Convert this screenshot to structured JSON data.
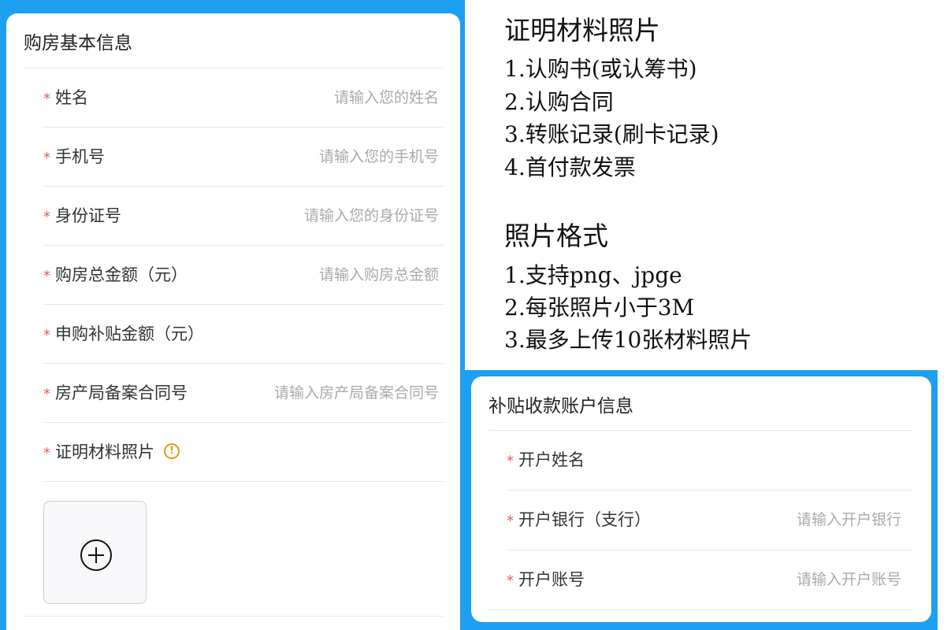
{
  "purchase_card": {
    "title": "购房基本信息",
    "fields": [
      {
        "label": "姓名",
        "placeholder": "请输入您的姓名"
      },
      {
        "label": "手机号",
        "placeholder": "请输入您的手机号"
      },
      {
        "label": "身份证号",
        "placeholder": "请输入您的身份证号"
      },
      {
        "label": "购房总金额（元）",
        "placeholder": "请输入购房总金额"
      },
      {
        "label": "申购补贴金额（元）",
        "placeholder": ""
      },
      {
        "label": "房产局备案合同号",
        "placeholder": "请输入房产局备案合同号"
      },
      {
        "label": "证明材料照片",
        "placeholder": ""
      }
    ],
    "required_mark": "*",
    "info_icon_glyph": "!"
  },
  "instructions": {
    "materials_heading": "证明材料照片",
    "materials": [
      "1.认购书(或认筹书)",
      "2.认购合同",
      "3.转账记录(刷卡记录)",
      "4.首付款发票"
    ],
    "format_heading": "照片格式",
    "formats": [
      "1.支持png、jpge",
      "2.每张照片小于3M",
      "3.最多上传10张材料照片"
    ]
  },
  "account_card": {
    "title": "补贴收款账户信息",
    "fields": [
      {
        "label": "开户姓名",
        "placeholder": ""
      },
      {
        "label": "开户银行（支行）",
        "placeholder": "请输入开户银行"
      },
      {
        "label": "开户账号",
        "placeholder": "请输入开户账号"
      }
    ]
  },
  "colors": {
    "brand_blue": "#1e9ff2",
    "required_red": "#e55a5a",
    "info_orange": "#e0a020"
  },
  "icons": {
    "upload": "plus-circle-icon",
    "info": "exclamation-circle-icon"
  }
}
